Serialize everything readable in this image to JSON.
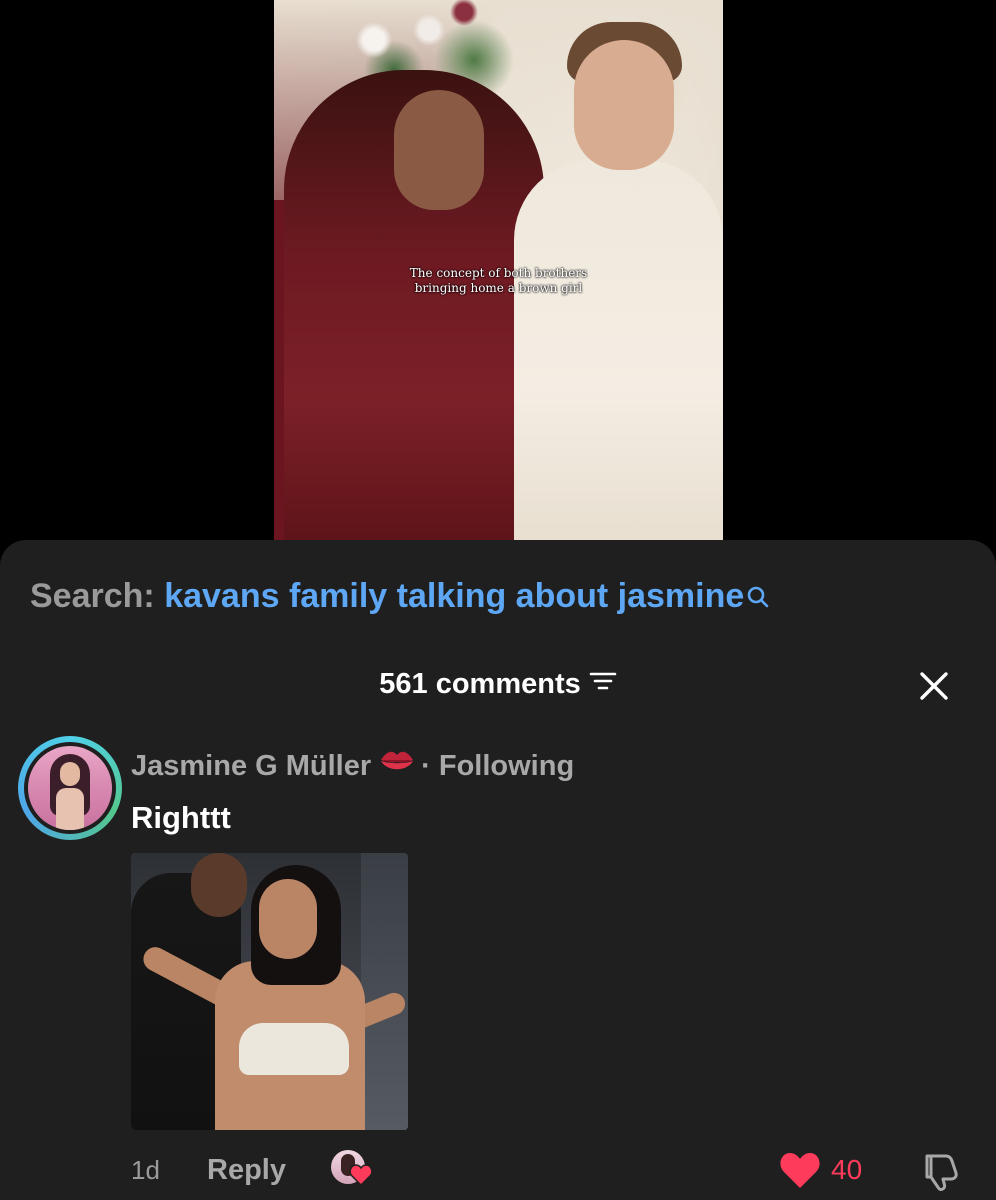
{
  "video": {
    "caption_line1": "The concept of both brothers",
    "caption_line2": "bringing home a brown girl"
  },
  "search": {
    "label": "Search:",
    "query": "kavans family talking about jasmine",
    "icon": "search-icon"
  },
  "comments_header": {
    "count_text": "561 comments",
    "filter_icon": "filter-icon",
    "close_icon": "close-icon"
  },
  "comment": {
    "username": "Jasmine G Müller",
    "badge_icon": "kiss-lips-icon",
    "following_text": "· Following",
    "text": "Righttt",
    "time": "1d",
    "reply_label": "Reply",
    "like_count": "40",
    "like_icon": "heart-icon",
    "dislike_icon": "dislike-icon",
    "creator_liked": true
  },
  "colors": {
    "sheet_bg": "#1f1f1f",
    "link_blue": "#5ea7f5",
    "like_red": "#ff3b5c",
    "muted_text": "#a8a8a8"
  }
}
